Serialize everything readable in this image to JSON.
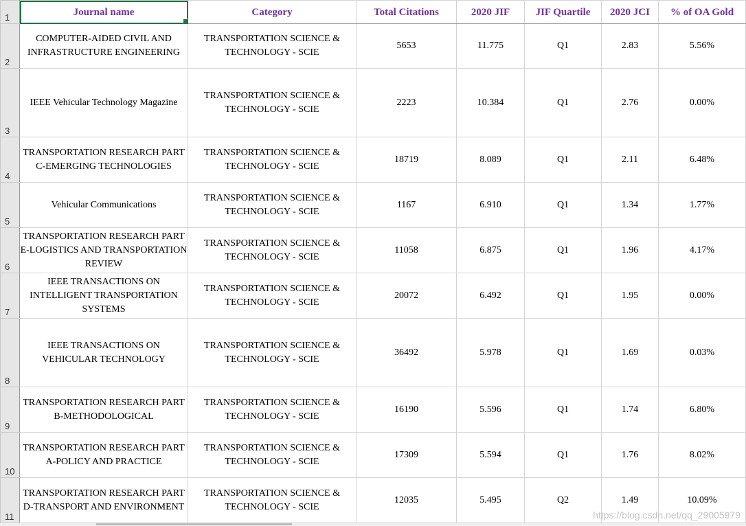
{
  "sheet": {
    "headers": [
      "Journal name",
      "Category",
      "Total Citations",
      "2020 JIF",
      "JIF Quartile",
      "2020 JCI",
      "% of OA Gold"
    ],
    "header_row_number": "1",
    "rows": [
      {
        "num": "2",
        "name": "COMPUTER-AIDED CIVIL AND INFRASTRUCTURE ENGINEERING",
        "category": "TRANSPORTATION SCIENCE & TECHNOLOGY - SCIE",
        "citations": "5653",
        "jif": "11.775",
        "quartile": "Q1",
        "jci": "2.83",
        "oa": "5.56%"
      },
      {
        "num": "3",
        "name": "IEEE Vehicular Technology Magazine",
        "category": "TRANSPORTATION SCIENCE & TECHNOLOGY - SCIE",
        "citations": "2223",
        "jif": "10.384",
        "quartile": "Q1",
        "jci": "2.76",
        "oa": "0.00%"
      },
      {
        "num": "4",
        "name": "TRANSPORTATION RESEARCH PART C-EMERGING TECHNOLOGIES",
        "category": "TRANSPORTATION SCIENCE & TECHNOLOGY - SCIE",
        "citations": "18719",
        "jif": "8.089",
        "quartile": "Q1",
        "jci": "2.11",
        "oa": "6.48%"
      },
      {
        "num": "5",
        "name": "Vehicular Communications",
        "category": "TRANSPORTATION SCIENCE & TECHNOLOGY - SCIE",
        "citations": "1167",
        "jif": "6.910",
        "quartile": "Q1",
        "jci": "1.34",
        "oa": "1.77%"
      },
      {
        "num": "6",
        "name": "TRANSPORTATION RESEARCH PART E-LOGISTICS AND TRANSPORTATION REVIEW",
        "category": "TRANSPORTATION SCIENCE & TECHNOLOGY - SCIE",
        "citations": "11058",
        "jif": "6.875",
        "quartile": "Q1",
        "jci": "1.96",
        "oa": "4.17%"
      },
      {
        "num": "7",
        "name": "IEEE TRANSACTIONS ON INTELLIGENT TRANSPORTATION SYSTEMS",
        "category": "TRANSPORTATION SCIENCE & TECHNOLOGY - SCIE",
        "citations": "20072",
        "jif": "6.492",
        "quartile": "Q1",
        "jci": "1.95",
        "oa": "0.00%"
      },
      {
        "num": "8",
        "name": "IEEE TRANSACTIONS ON VEHICULAR TECHNOLOGY",
        "category": "TRANSPORTATION SCIENCE & TECHNOLOGY - SCIE",
        "citations": "36492",
        "jif": "5.978",
        "quartile": "Q1",
        "jci": "1.69",
        "oa": "0.03%"
      },
      {
        "num": "9",
        "name": "TRANSPORTATION RESEARCH PART B-METHODOLOGICAL",
        "category": "TRANSPORTATION SCIENCE & TECHNOLOGY - SCIE",
        "citations": "16190",
        "jif": "5.596",
        "quartile": "Q1",
        "jci": "1.74",
        "oa": "6.80%"
      },
      {
        "num": "10",
        "name": "TRANSPORTATION RESEARCH PART A-POLICY AND PRACTICE",
        "category": "TRANSPORTATION SCIENCE & TECHNOLOGY - SCIE",
        "citations": "17309",
        "jif": "5.594",
        "quartile": "Q1",
        "jci": "1.76",
        "oa": "8.02%"
      },
      {
        "num": "11",
        "name": "TRANSPORTATION RESEARCH PART D-TRANSPORT AND ENVIRONMENT",
        "category": "TRANSPORTATION SCIENCE & TECHNOLOGY - SCIE",
        "citations": "12035",
        "jif": "5.495",
        "quartile": "Q2",
        "jci": "1.49",
        "oa": "10.09%"
      }
    ]
  },
  "watermark": "https://blog.csdn.net/qq_29005979",
  "colors": {
    "header_text": "#7030a0",
    "grid_line": "#d4d4d4",
    "row_header_bg": "#e6e6e6",
    "selection": "#217346"
  }
}
